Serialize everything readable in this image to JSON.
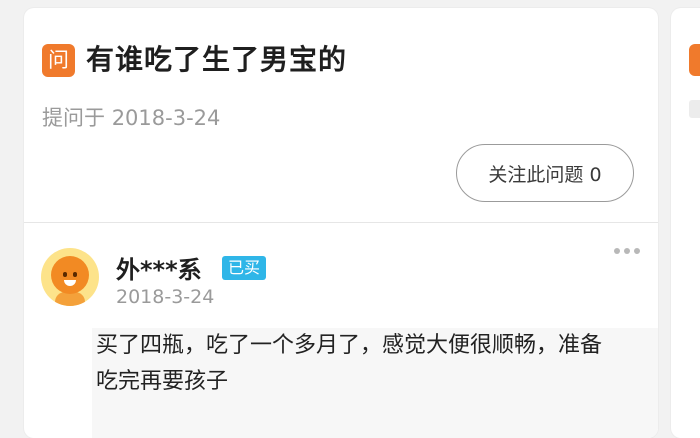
{
  "question": {
    "badge": "问",
    "title": "有谁吃了生了男宝的",
    "asked_prefix": "提问于",
    "asked_date": "2018-3-24",
    "follow_button": "关注此问题 0"
  },
  "answer": {
    "username": "外***系",
    "bought_badge": "已买",
    "date": "2018-3-24",
    "text": "买了四瓶，吃了一个多月了，感觉大便很顺畅，准备吃完再要孩子"
  },
  "colors": {
    "accent_orange": "#f07a2c",
    "badge_blue": "#2fb6e8",
    "muted_text": "#9a9a9a"
  },
  "icons": {
    "avatar": "cartoon-mascot-avatar",
    "more": "more-dots-icon"
  }
}
